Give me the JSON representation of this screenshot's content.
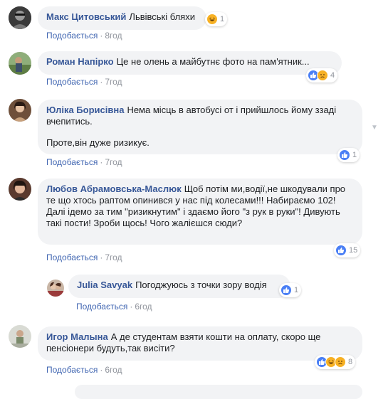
{
  "comments": [
    {
      "author": "Макс Цитовський",
      "text": "Львівські бляхи",
      "like_label": "Подобається",
      "time": "8год",
      "reaction_count": "1"
    },
    {
      "author": "Роман Напірко",
      "text": "Це не олень а майбутнє фото на пам'ятник...",
      "like_label": "Подобається",
      "time": "7год",
      "reaction_count": "4"
    },
    {
      "author": "Юліка Борисівна",
      "text": "Нема місць в автобусі от і прийшлось йому ззаді вчепитись.",
      "text2": "Проте,він дуже ризикує.",
      "like_label": "Подобається",
      "time": "7год",
      "reaction_count": "1"
    },
    {
      "author": "Любов Абрамовська-Маслюк",
      "text": "Щоб потім ми,водії,не шкодували про те що хтось раптом опинився у нас під колесами!!! Набираємо 102! Далі ідемо за тим \"ризикнутим\" і здаємо його \"з рук в руки\"! Дивують такі пости! Зроби щось! Чого жалієшся сюди?",
      "like_label": "Подобається",
      "time": "7год",
      "reaction_count": "15"
    },
    {
      "author": "Julia Savyak",
      "text": "Погоджуюсь з точки зору водія",
      "like_label": "Подобається",
      "time": "6год",
      "reaction_count": "1"
    },
    {
      "author": "Игор Малына",
      "text": "А де студентам взяти кошти на оплату, скоро ще пенсіонери будуть,так висіти?",
      "like_label": "Подобається",
      "time": "6год",
      "reaction_count": "8"
    }
  ],
  "colors": {
    "author": "#385898",
    "bubble": "#f2f3f5",
    "meta": "#90949c",
    "like": "#4267b2"
  }
}
